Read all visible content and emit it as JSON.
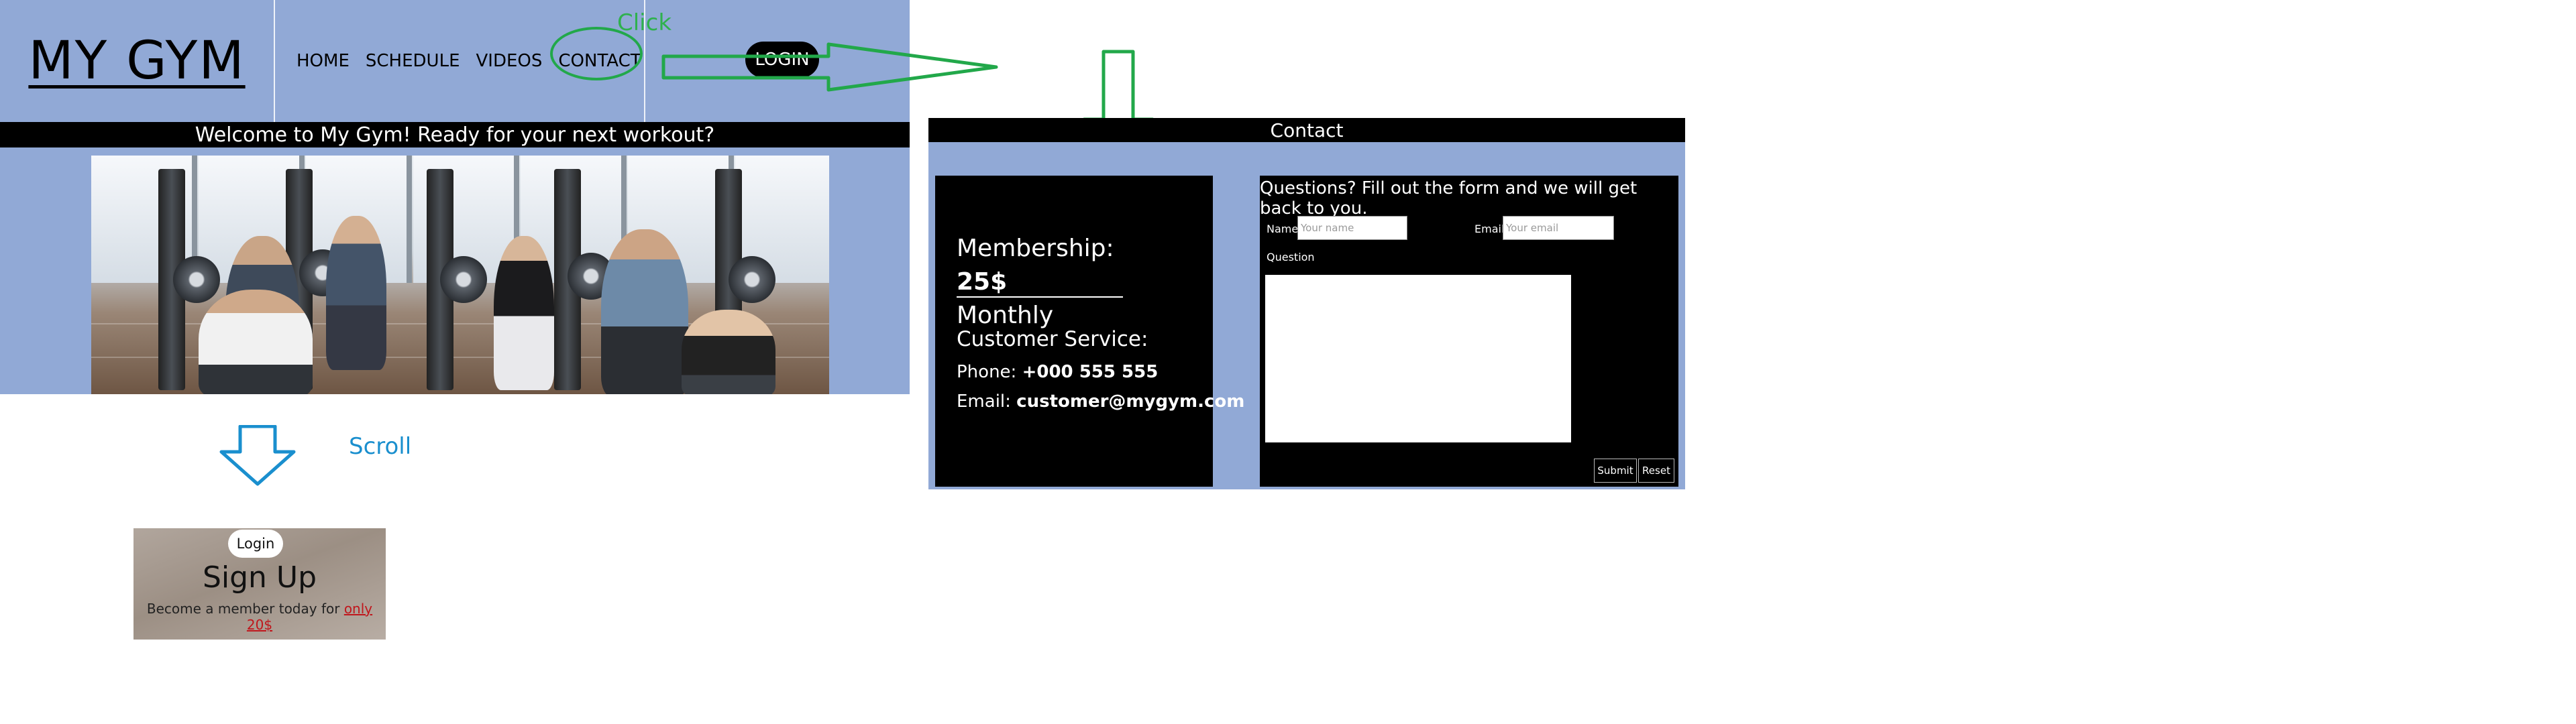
{
  "annotations": {
    "click_label": "Click",
    "scroll_label": "Scroll",
    "click_color": "#22a84a",
    "scroll_color": "#1a8fce"
  },
  "home": {
    "logo": "MY GYM",
    "nav": [
      "HOME",
      "SCHEDULE",
      "VIDEOS",
      "CONTACT"
    ],
    "login": "LOGIN",
    "welcome": "Welcome to My Gym! Ready for your next workout?",
    "header_color": "#91a9d6"
  },
  "signup": {
    "login": "Login",
    "title": "Sign Up",
    "text": "Become a member today for",
    "price": "only 20$"
  },
  "contact": {
    "title": "Contact",
    "membership_label": "Membership:",
    "membership_price": "25$",
    "membership_period": "Monthly",
    "customer_service": "Customer Service:",
    "phone_label": "Phone:",
    "phone": "+000 555 555",
    "email_label": "Email:",
    "email": "customer@mygym.com",
    "form": {
      "heading": "Questions? Fill out the form and we will get back to you.",
      "name_label": "Name",
      "name_placeholder": "Your name",
      "email_label": "Email",
      "email_placeholder": "Your email",
      "question_label": "Question",
      "submit": "Submit",
      "reset": "Reset"
    }
  }
}
